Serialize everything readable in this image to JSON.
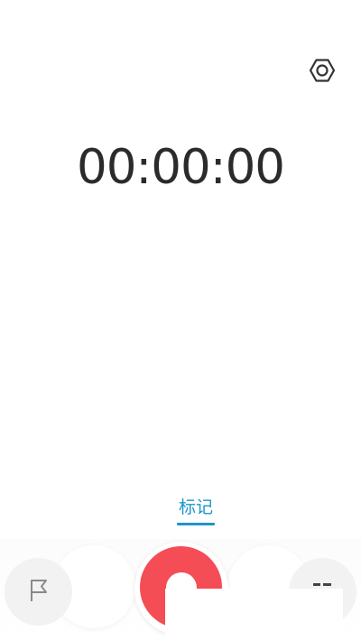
{
  "header": {
    "settings_icon": "settings-gear-icon"
  },
  "timer": {
    "value": "00:00:00"
  },
  "mark": {
    "label": "标记"
  },
  "controls": {
    "flag_icon": "flag-icon",
    "record_icon": "record-icon",
    "list_icon": "recordings-list-icon"
  },
  "colors": {
    "accent": "#1f95c9",
    "record": "#f44d55",
    "text": "#2b2b2b",
    "button_bg": "#f2f2f2"
  }
}
